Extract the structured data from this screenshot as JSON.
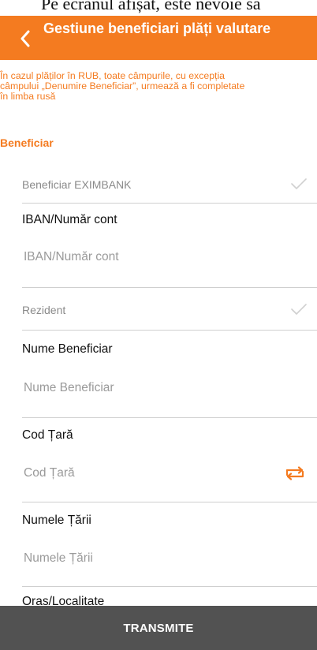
{
  "top_cut_text": "Pe ecranul afișat, este nevoie să",
  "header": {
    "title": "Gestiune beneficiari plăți valutare"
  },
  "notice": "În cazul plăților în RUB, toate câmpurile, cu excepția\ncâmpului „Denumire Beneficiar”, urmează a fi completate\nîn limba rusă",
  "section_title": "Beneficiar",
  "form": {
    "eximbank_label": "Beneficiar EXIMBANK",
    "iban_label": "IBAN/Număr cont",
    "iban_placeholder": "IBAN/Număr cont",
    "rezident_label": "Rezident",
    "nume_label": "Nume Beneficiar",
    "nume_placeholder": "Nume Beneficiar",
    "cod_tara_label": "Cod Țară",
    "cod_tara_placeholder": "Cod Țară",
    "numele_tarii_label": "Numele Țării",
    "numele_tarii_placeholder": "Numele Țării",
    "oras_label": "Oraș/Localitate"
  },
  "submit_label": "TRANSMITE",
  "colors": {
    "accent": "#f47b20",
    "submit_bg": "#525252",
    "check": "#d0d0d0"
  }
}
